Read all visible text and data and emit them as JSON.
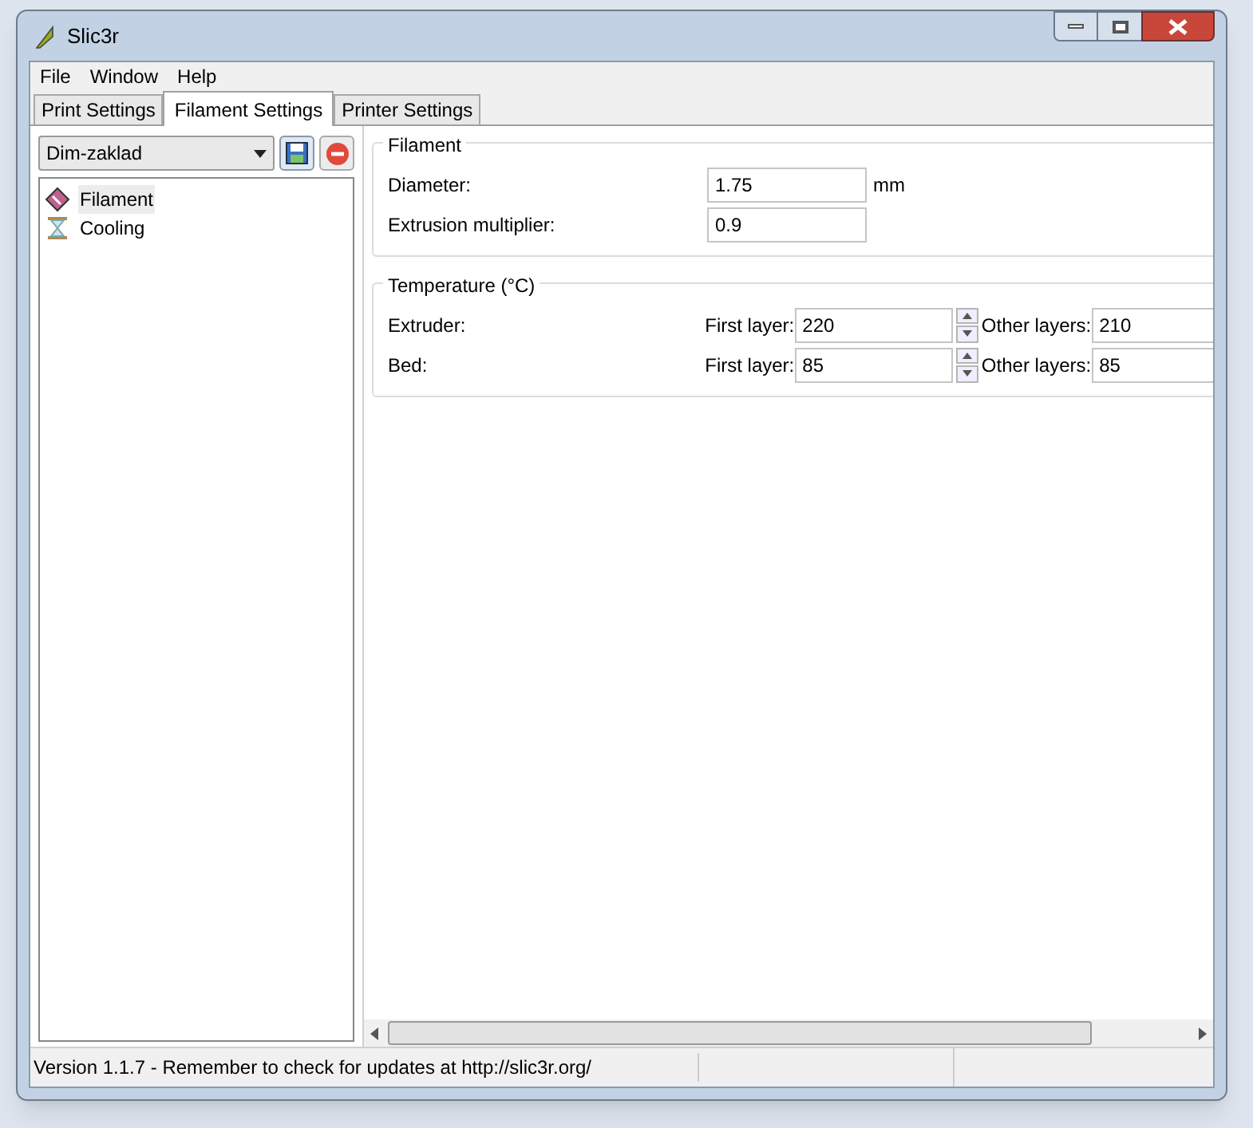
{
  "window": {
    "title": "Slic3r"
  },
  "menu": [
    "File",
    "Window",
    "Help"
  ],
  "tabs": [
    {
      "label": "Print Settings",
      "selected": false
    },
    {
      "label": "Filament Settings",
      "selected": true
    },
    {
      "label": "Printer Settings",
      "selected": false
    }
  ],
  "preset": {
    "value": "Dim-zaklad"
  },
  "tree": [
    {
      "label": "Filament",
      "kind": "filament",
      "selected": true
    },
    {
      "label": "Cooling",
      "kind": "cooling",
      "selected": false
    }
  ],
  "sections": [
    {
      "title": "Filament",
      "rows": [
        {
          "kind": "single",
          "label": "Diameter:",
          "value": "1.75",
          "unit": "mm"
        },
        {
          "kind": "single",
          "label": "Extrusion multiplier:",
          "value": "0.9"
        }
      ]
    },
    {
      "title": "Temperature (°C)",
      "rows": [
        {
          "kind": "pair",
          "label": "Extruder:",
          "first_label": "First layer:",
          "first_value": "220",
          "other_label": "Other layers:",
          "other_value": "210"
        },
        {
          "kind": "pair",
          "label": "Bed:",
          "first_label": "First layer:",
          "first_value": "85",
          "other_label": "Other layers:",
          "other_value": "85"
        }
      ]
    }
  ],
  "status_bar": {
    "text": "Version 1.1.7 - Remember to check for updates at http://slic3r.org/"
  }
}
